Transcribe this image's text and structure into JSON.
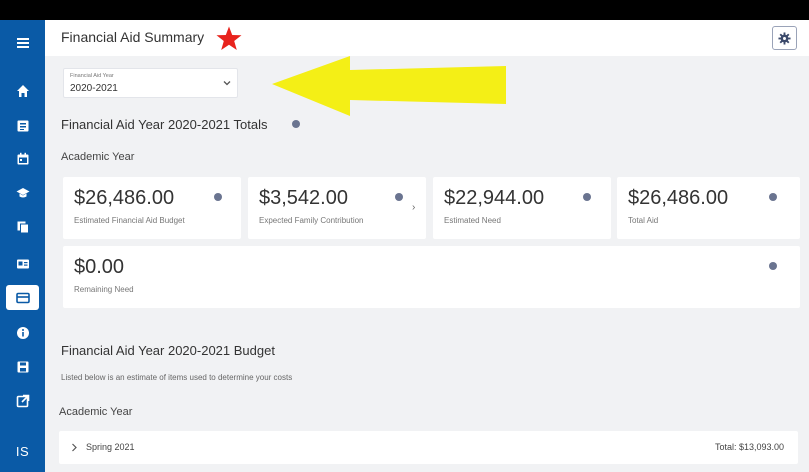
{
  "sidebar": {
    "icons": [
      "menu-icon",
      "home-icon",
      "list-icon",
      "calendar-icon",
      "graduation-cap-icon",
      "documents-icon",
      "id-card-icon",
      "financial-aid-icon",
      "info-icon",
      "save-icon",
      "external-link-icon"
    ],
    "initials": "IS"
  },
  "header": {
    "title": "Financial Aid Summary",
    "settings_icon": "gear-icon"
  },
  "year_select": {
    "label": "Financial Aid Year",
    "value": "2020-2021"
  },
  "totals": {
    "heading": "Financial Aid Year 2020-2021 Totals",
    "section_label": "Academic Year",
    "cards": [
      {
        "amount": "$26,486.00",
        "caption": "Estimated Financial Aid Budget"
      },
      {
        "amount": "$3,542.00",
        "caption": "Expected Family Contribution"
      },
      {
        "amount": "$22,944.00",
        "caption": "Estimated Need"
      },
      {
        "amount": "$26,486.00",
        "caption": "Total Aid"
      },
      {
        "amount": "$0.00",
        "caption": "Remaining Need"
      }
    ],
    "caret": "›"
  },
  "budget": {
    "heading": "Financial Aid Year 2020-2021 Budget",
    "description": "Listed below is an estimate of items used to determine your costs",
    "section_label": "Academic Year",
    "terms": [
      {
        "name": "Spring 2021",
        "total": "Total: $13,093.00"
      }
    ]
  },
  "colors": {
    "sidebar": "#0a5aa6",
    "background": "#f1f2f4",
    "annotation_star": "#e8231d",
    "annotation_arrow": "#f4ef16"
  }
}
